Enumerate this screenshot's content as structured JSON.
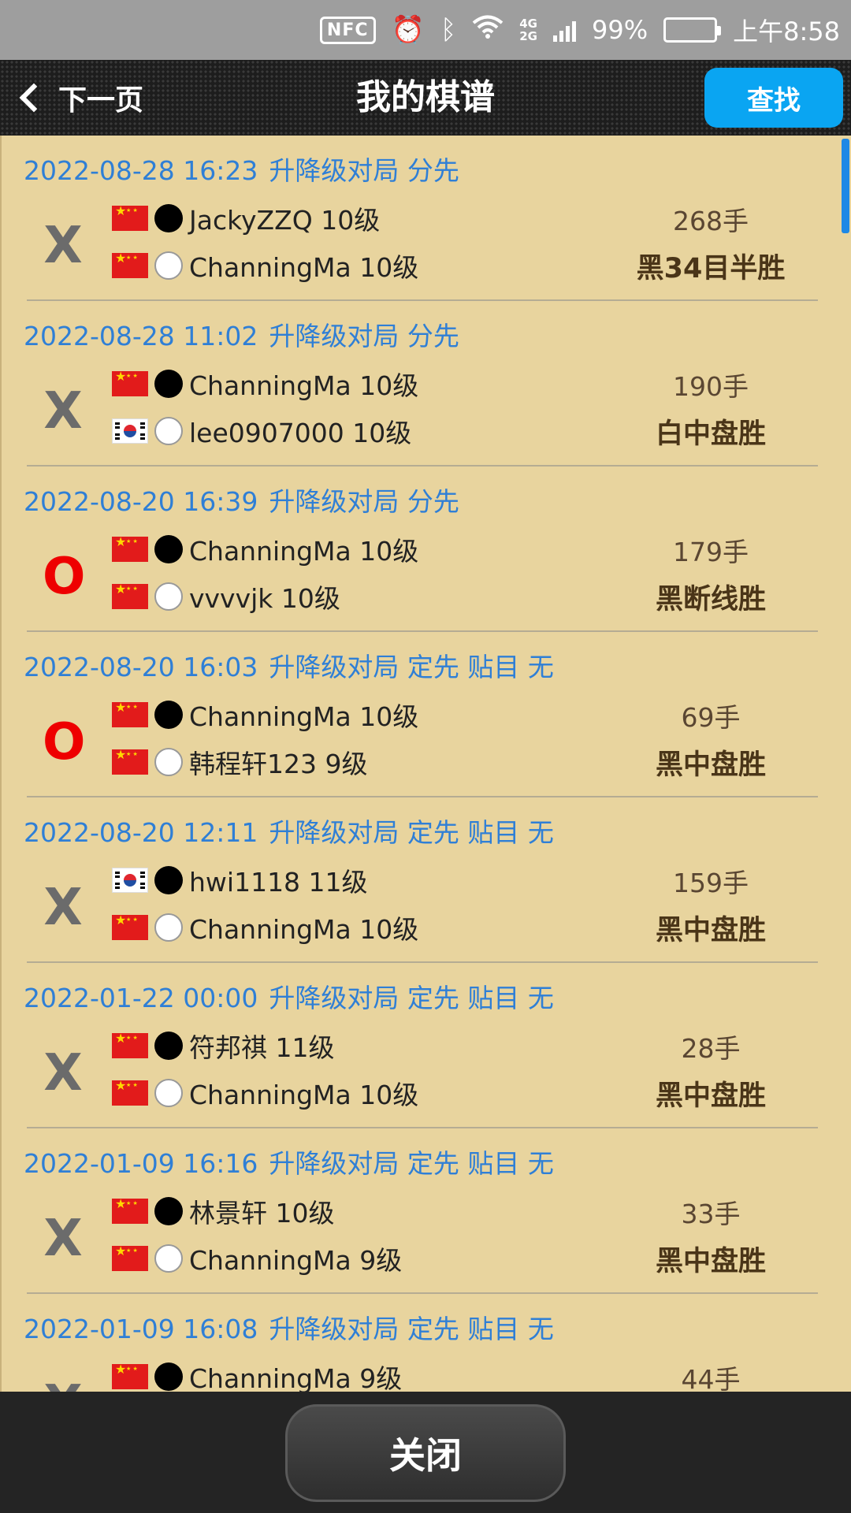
{
  "status_bar": {
    "nfc": "NFC",
    "net_top": "4G",
    "net_bottom": "2G",
    "battery": "99%",
    "time": "上午8:58",
    "icons": [
      "nfc-icon",
      "alarm-icon",
      "bluetooth-icon",
      "wifi-icon",
      "signal-icon",
      "battery-icon"
    ]
  },
  "header": {
    "back_label": "下一页",
    "title": "我的棋谱",
    "find_label": "查找"
  },
  "colors": {
    "list_bg": "#e8d49e",
    "header_link": "#2f7fd6",
    "loss_mark": "#6b6b6b",
    "win_mark": "#ee0000",
    "find_button": "#0aa5f2"
  },
  "records": [
    {
      "date": "2022-08-28 16:23",
      "info": "升降级对局 分先",
      "mark": "X",
      "mark_type": "x",
      "p1": {
        "flag": "cn",
        "stone": "black",
        "name": "JackyZZQ 10级"
      },
      "p2": {
        "flag": "cn",
        "stone": "white",
        "name": "ChanningMa 10级"
      },
      "moves": "268手",
      "result": "黑34目半胜"
    },
    {
      "date": "2022-08-28 11:02",
      "info": "升降级对局 分先",
      "mark": "X",
      "mark_type": "x",
      "p1": {
        "flag": "cn",
        "stone": "black",
        "name": "ChanningMa 10级"
      },
      "p2": {
        "flag": "kr",
        "stone": "white",
        "name": "lee0907000 10级"
      },
      "moves": "190手",
      "result": "白中盘胜"
    },
    {
      "date": "2022-08-20 16:39",
      "info": "升降级对局 分先",
      "mark": "O",
      "mark_type": "o",
      "p1": {
        "flag": "cn",
        "stone": "black",
        "name": "ChanningMa 10级"
      },
      "p2": {
        "flag": "cn",
        "stone": "white",
        "name": "vvvvjk 10级"
      },
      "moves": "179手",
      "result": "黑断线胜"
    },
    {
      "date": "2022-08-20 16:03",
      "info": "升降级对局 定先 贴目 无",
      "mark": "O",
      "mark_type": "o",
      "p1": {
        "flag": "cn",
        "stone": "black",
        "name": "ChanningMa 10级"
      },
      "p2": {
        "flag": "cn",
        "stone": "white",
        "name": "韩程轩123 9级"
      },
      "moves": "69手",
      "result": "黑中盘胜"
    },
    {
      "date": "2022-08-20 12:11",
      "info": "升降级对局 定先 贴目 无",
      "mark": "X",
      "mark_type": "x",
      "p1": {
        "flag": "kr",
        "stone": "black",
        "name": "hwi1118 11级"
      },
      "p2": {
        "flag": "cn",
        "stone": "white",
        "name": "ChanningMa 10级"
      },
      "moves": "159手",
      "result": "黑中盘胜"
    },
    {
      "date": "2022-01-22 00:00",
      "info": "升降级对局 定先 贴目 无",
      "mark": "X",
      "mark_type": "x",
      "p1": {
        "flag": "cn",
        "stone": "black",
        "name": "符邦祺 11级"
      },
      "p2": {
        "flag": "cn",
        "stone": "white",
        "name": "ChanningMa 10级"
      },
      "moves": "28手",
      "result": "黑中盘胜"
    },
    {
      "date": "2022-01-09 16:16",
      "info": "升降级对局 定先 贴目 无",
      "mark": "X",
      "mark_type": "x",
      "p1": {
        "flag": "cn",
        "stone": "black",
        "name": "林景轩 10级"
      },
      "p2": {
        "flag": "cn",
        "stone": "white",
        "name": "ChanningMa 9级"
      },
      "moves": "33手",
      "result": "黑中盘胜"
    },
    {
      "date": "2022-01-09 16:08",
      "info": "升降级对局 定先 贴目 无",
      "mark": "X",
      "mark_type": "x",
      "p1": {
        "flag": "cn",
        "stone": "black",
        "name": "ChanningMa 9级"
      },
      "p2": {
        "flag": "cn",
        "stone": "white",
        "name": ""
      },
      "moves": "44手",
      "result": ""
    }
  ],
  "footer": {
    "close_label": "关闭"
  }
}
